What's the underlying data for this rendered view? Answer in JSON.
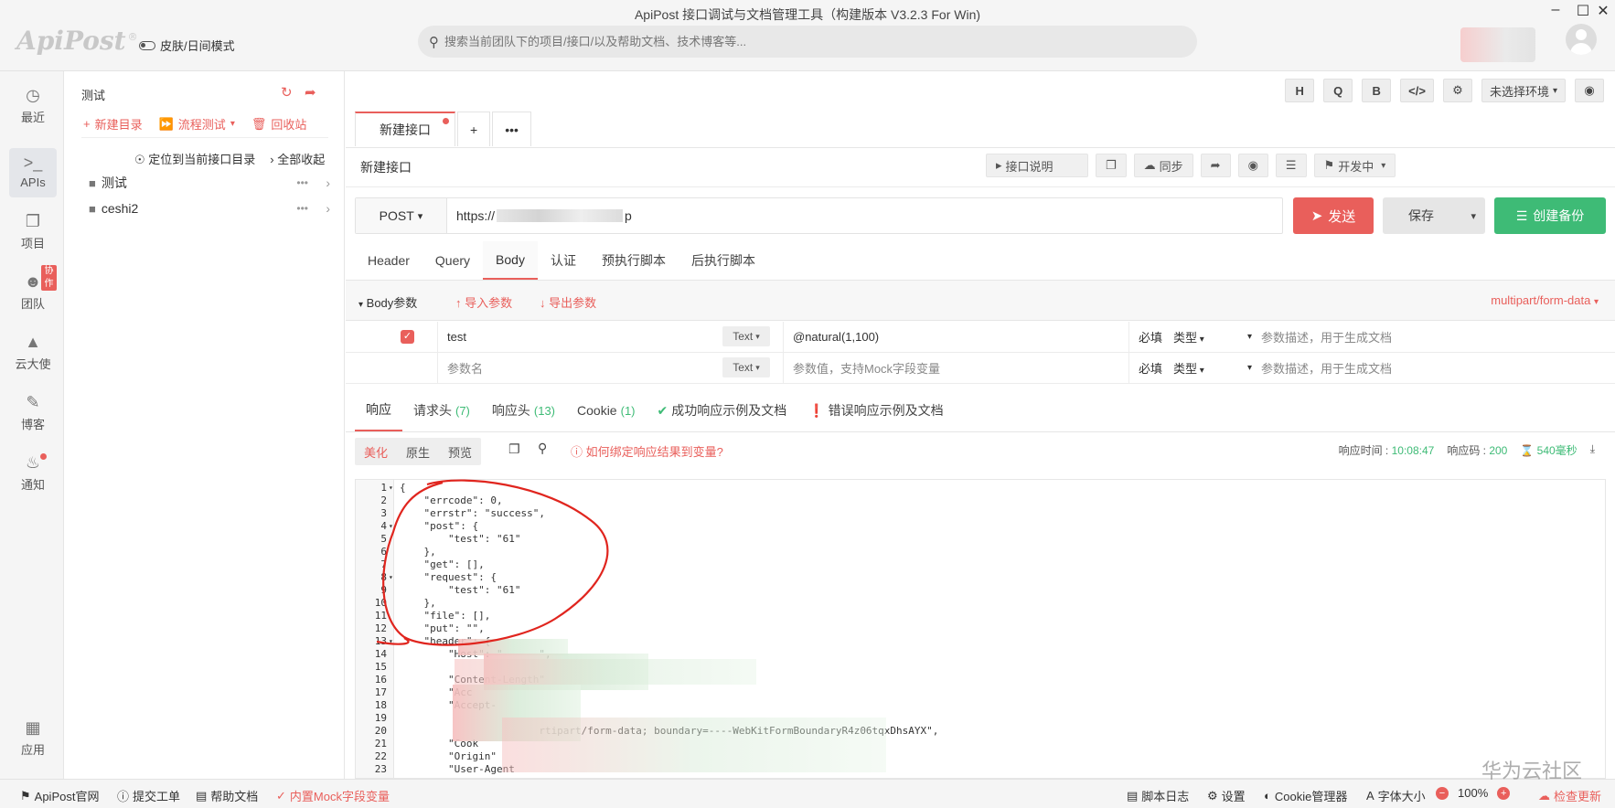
{
  "window": {
    "title": "ApiPost 接口调试与文档管理工具（构建版本 V3.2.3 For Win)"
  },
  "header": {
    "logo": "ApiPost",
    "logo_mark": "®",
    "skin_toggle": "皮肤/日间模式",
    "search_placeholder": "搜索当前团队下的项目/接口/以及帮助文档、技术博客等..."
  },
  "rail": {
    "items": [
      {
        "label": "最近",
        "icon": "clock-icon"
      },
      {
        "label": "APIs",
        "icon": "terminal-icon"
      },
      {
        "label": "项目",
        "icon": "project-icon"
      },
      {
        "label": "团队",
        "icon": "team-icon",
        "badge": "协作"
      },
      {
        "label": "云大使",
        "icon": "graduation-icon"
      },
      {
        "label": "博客",
        "icon": "edit-icon"
      },
      {
        "label": "通知",
        "icon": "bell-icon"
      },
      {
        "label": "应用",
        "icon": "apps-icon"
      }
    ]
  },
  "tree": {
    "title": "测试",
    "new_dir": "新建目录",
    "flow_test": "流程测试",
    "recycle": "回收站",
    "locate": "定位到当前接口目录",
    "collapse_all": "全部收起",
    "folders": [
      {
        "name": "测试"
      },
      {
        "name": "ceshi2"
      }
    ]
  },
  "toolbar": {
    "buttons": [
      "H",
      "Q",
      "B",
      "</>",
      "⚙"
    ],
    "env": "未选择环境"
  },
  "tabs": {
    "active": "新建接口"
  },
  "api": {
    "name": "新建接口",
    "desc_btn": "接口说明",
    "sync": "同步",
    "status": "开发中"
  },
  "request": {
    "method": "POST",
    "url_prefix": "https://",
    "url_suffix": "p",
    "send": "发送",
    "save": "保存",
    "backup": "创建备份",
    "tabs": [
      "Header",
      "Query",
      "Body",
      "认证",
      "预执行脚本",
      "后执行脚本"
    ],
    "active_tab": "Body"
  },
  "body": {
    "title": "Body参数",
    "import": "导入参数",
    "export": "导出参数",
    "content_type": "multipart/form-data",
    "rows": [
      {
        "key": "test",
        "type": "Text",
        "value": "@natural(1,100)",
        "required": "必填",
        "ptype": "类型",
        "desc_placeholder": "参数描述，用于生成文档"
      },
      {
        "key_placeholder": "参数名",
        "type": "Text",
        "value_placeholder": "参数值，支持Mock字段变量",
        "required": "必填",
        "ptype": "类型",
        "desc_placeholder": "参数描述，用于生成文档"
      }
    ]
  },
  "response": {
    "tabs": [
      {
        "label": "响应"
      },
      {
        "label": "请求头",
        "count": "(7)"
      },
      {
        "label": "响应头",
        "count": "(13)"
      },
      {
        "label": "Cookie",
        "count": "(1)"
      },
      {
        "label": "成功响应示例及文档"
      },
      {
        "label": "错误响应示例及文档"
      }
    ],
    "views": [
      "美化",
      "原生",
      "预览"
    ],
    "bind_help": "如何绑定响应结果到变量?",
    "time_label": "响应时间 :",
    "time": "10:08:47",
    "code_label": "响应码 :",
    "code": "200",
    "duration": "540毫秒"
  },
  "code_lines": [
    {
      "n": "1",
      "fold": true,
      "text": "{"
    },
    {
      "n": "2",
      "text": "    \"errcode\": 0,"
    },
    {
      "n": "3",
      "text": "    \"errstr\": \"success\","
    },
    {
      "n": "4",
      "fold": true,
      "text": "    \"post\": {"
    },
    {
      "n": "5",
      "text": "        \"test\": \"61\""
    },
    {
      "n": "6",
      "text": "    },"
    },
    {
      "n": "7",
      "text": "    \"get\": [],"
    },
    {
      "n": "8",
      "fold": true,
      "text": "    \"request\": {"
    },
    {
      "n": "9",
      "text": "        \"test\": \"61\""
    },
    {
      "n": "10",
      "text": "    },"
    },
    {
      "n": "11",
      "text": "    \"file\": [],"
    },
    {
      "n": "12",
      "text": "    \"put\": \"\","
    },
    {
      "n": "13",
      "fold": true,
      "text": "    \"header\": {"
    },
    {
      "n": "14",
      "text": "        \"Host\": \"      \","
    },
    {
      "n": "15",
      "text": ""
    },
    {
      "n": "16",
      "text": "        \"Content-Length\""
    },
    {
      "n": "17",
      "text": "        \"Acc"
    },
    {
      "n": "18",
      "text": "        \"Accept-"
    },
    {
      "n": "19",
      "text": ""
    },
    {
      "n": "20",
      "text": "                       rtipart/form-data; boundary=----WebKitFormBoundaryR4z06tqxDhsAYX\","
    },
    {
      "n": "21",
      "text": "        \"Cook"
    },
    {
      "n": "22",
      "text": "        \"Origin\""
    },
    {
      "n": "23",
      "text": "        \"User-Agent"
    }
  ],
  "statusbar": {
    "official": "ApiPost官网",
    "ticket": "提交工单",
    "help": "帮助文档",
    "mock": "内置Mock字段变量",
    "script_log": "脚本日志",
    "settings": "设置",
    "cookie_mgr": "Cookie管理器",
    "font_size": "字体大小",
    "zoom": "100%",
    "update": "检查更新"
  },
  "watermark": "华为云社区",
  "colors": {
    "accent": "#e95f5b",
    "success": "#3ebb76"
  }
}
